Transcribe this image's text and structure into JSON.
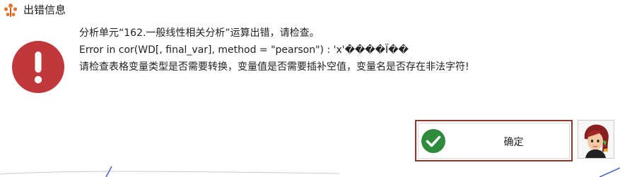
{
  "window": {
    "title": "出错信息",
    "icon": "app-logo-icon"
  },
  "message": {
    "line1": "分析单元“162.一般线性相关分析”运算出错，请检查。",
    "line2": "Error in cor(WD[, final_var], method = \"pearson\") : 'x'����Ï��",
    "line3": "请检查表格变量类型是否需要转换，变量值是否需要插补空值，变量名是否存在非法字符!",
    "icon": "error-icon"
  },
  "buttons": {
    "ok_label": "确定",
    "ok_icon": "checkmark-icon"
  },
  "assistant": {
    "icon": "assistant-avatar-icon"
  },
  "colors": {
    "error_red": "#c0383b",
    "ok_green": "#2e8b3c",
    "button_border": "#8b3a2a"
  }
}
